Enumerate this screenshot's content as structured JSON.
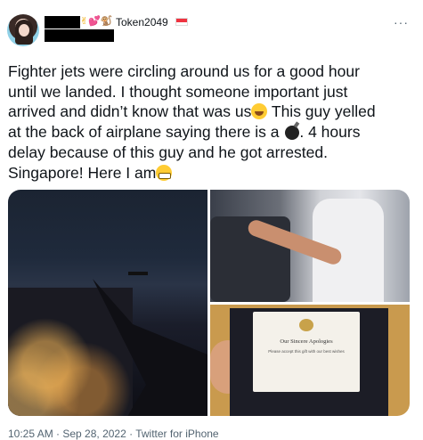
{
  "user": {
    "handle": "Token2049",
    "emoji_decorations": [
      "✌",
      "💕",
      "🐒"
    ],
    "avatar": "woman-portrait-avatar"
  },
  "tweet": {
    "lines": [
      "Fighter jets were circling around us for a good hour",
      "until we landed. I thought someone important just",
      "arrived and didn’t know that was us",
      " This guy yelled",
      "at the back of airplane saying there is a ",
      ". 4 hours",
      "delay because of this guy and he got arrested.",
      "Singapore! Here I am"
    ]
  },
  "media": {
    "card_title": "Our Sincere Apologies",
    "card_body": "Please accept this gift with our best wishes"
  },
  "footer": {
    "timestamp": "10:25 AM · Sep 28, 2022 · Twitter for iPhone"
  },
  "icons": {
    "more": "more-options-icon",
    "flag": "singapore-flag-icon"
  },
  "colors": {
    "text": "#0f1419",
    "muted": "#536471",
    "flag_red": "#ef3340"
  }
}
